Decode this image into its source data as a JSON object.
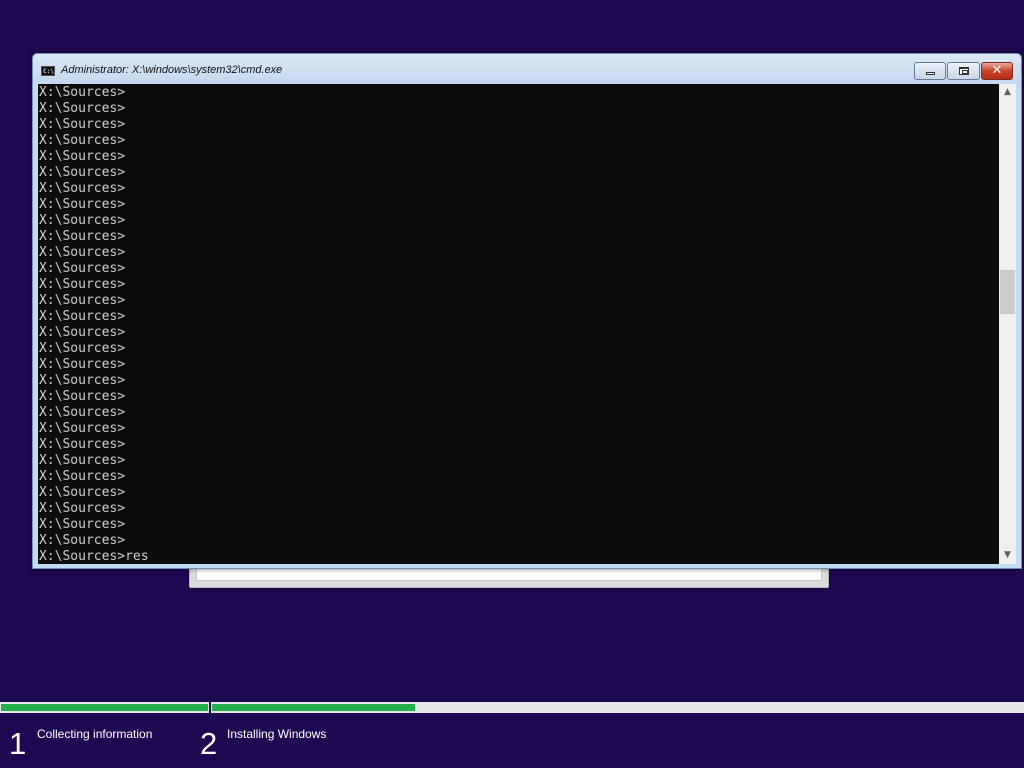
{
  "window": {
    "title": "Administrator: X:\\windows\\system32\\cmd.exe",
    "icon": "cmd-icon",
    "buttons": {
      "minimize": "minimize-icon",
      "maximize": "restore-icon",
      "close": "✕"
    }
  },
  "console": {
    "lines": [
      "X:\\Sources>",
      "X:\\Sources>",
      "X:\\Sources>",
      "X:\\Sources>",
      "X:\\Sources>",
      "X:\\Sources>",
      "X:\\Sources>",
      "X:\\Sources>",
      "X:\\Sources>",
      "X:\\Sources>",
      "X:\\Sources>",
      "X:\\Sources>",
      "X:\\Sources>",
      "X:\\Sources>",
      "X:\\Sources>",
      "X:\\Sources>",
      "X:\\Sources>",
      "X:\\Sources>",
      "X:\\Sources>",
      "X:\\Sources>",
      "X:\\Sources>",
      "X:\\Sources>",
      "X:\\Sources>",
      "X:\\Sources>",
      "X:\\Sources>",
      "X:\\Sources>",
      "X:\\Sources>",
      "X:\\Sources>",
      "X:\\Sources>",
      "X:\\Sources>res"
    ],
    "scroll_position": 0.42
  },
  "setup": {
    "steps": [
      {
        "number": "1",
        "label": "Collecting information",
        "progress": 1.0
      },
      {
        "number": "2",
        "label": "Installing Windows",
        "progress": 0.25
      }
    ]
  },
  "colors": {
    "background": "#1f0852",
    "console_bg": "#0c0c0c",
    "console_text": "#cccccc",
    "progress": "#22b14c"
  }
}
